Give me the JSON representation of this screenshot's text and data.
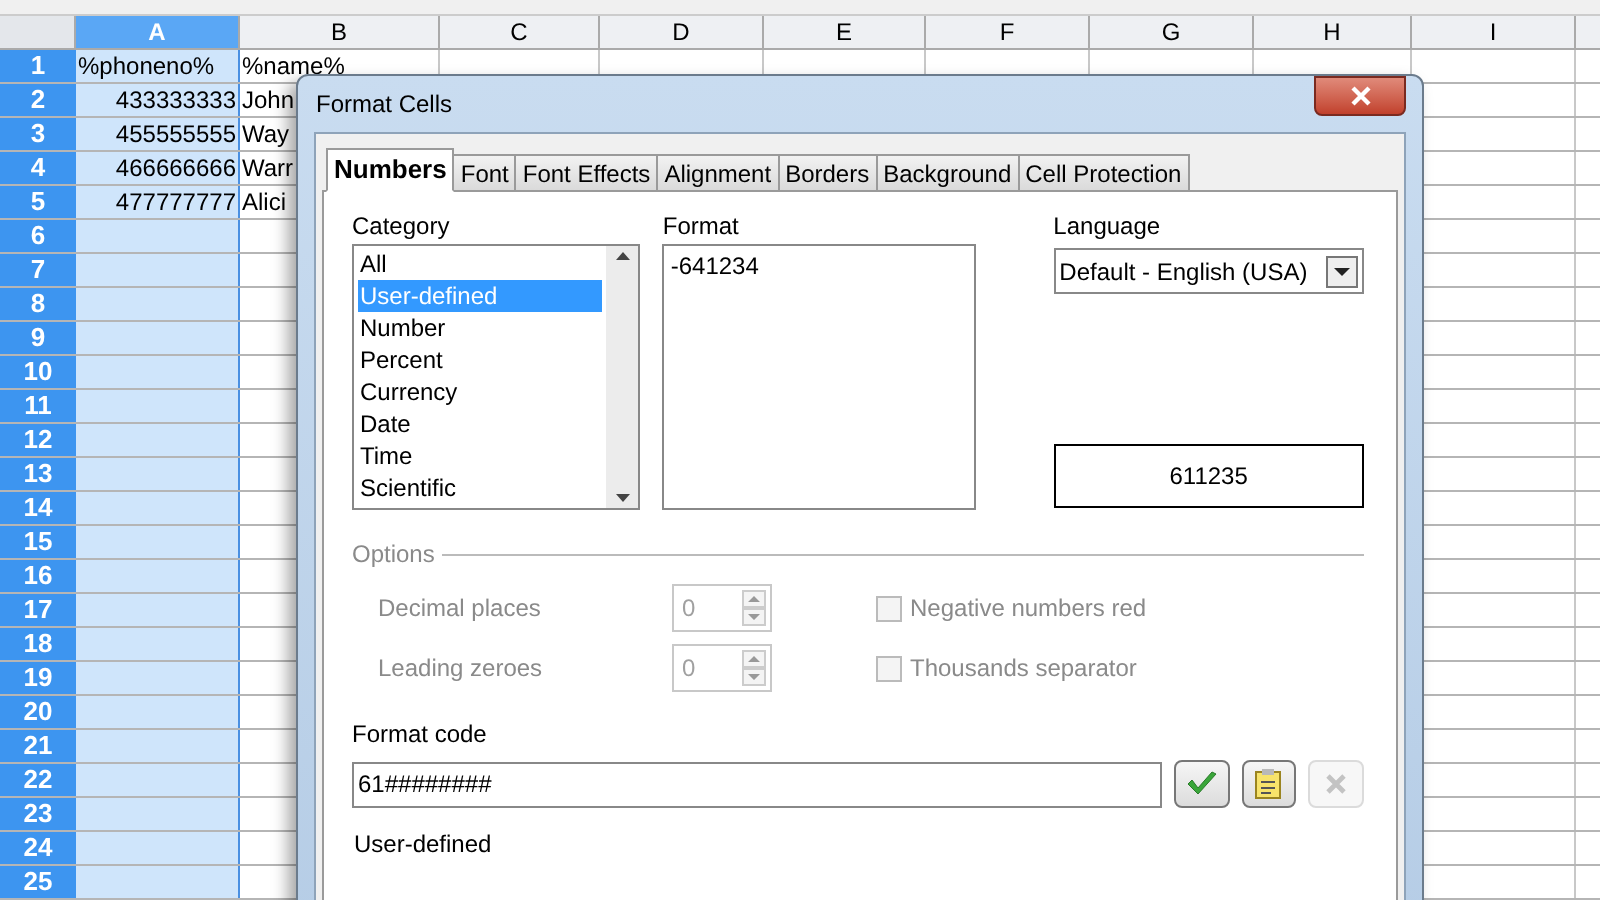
{
  "sheet": {
    "columns": [
      {
        "label": "A",
        "selected": true
      },
      {
        "label": "B",
        "selected": false
      },
      {
        "label": "C",
        "selected": false
      },
      {
        "label": "D",
        "selected": false
      },
      {
        "label": "E",
        "selected": false
      },
      {
        "label": "F",
        "selected": false
      },
      {
        "label": "G",
        "selected": false
      },
      {
        "label": "H",
        "selected": false
      },
      {
        "label": "I",
        "selected": false
      }
    ],
    "rows": [
      {
        "label": "1",
        "cells": [
          "%phoneno%",
          "%name%"
        ]
      },
      {
        "label": "2",
        "cells": [
          "433333333",
          "John"
        ]
      },
      {
        "label": "3",
        "cells": [
          "455555555",
          "Way"
        ]
      },
      {
        "label": "4",
        "cells": [
          "466666666",
          "Warr"
        ]
      },
      {
        "label": "5",
        "cells": [
          "477777777",
          "Alici"
        ]
      },
      {
        "label": "6",
        "cells": []
      },
      {
        "label": "7",
        "cells": []
      },
      {
        "label": "8",
        "cells": []
      },
      {
        "label": "9",
        "cells": []
      },
      {
        "label": "10",
        "cells": []
      },
      {
        "label": "11",
        "cells": []
      },
      {
        "label": "12",
        "cells": []
      },
      {
        "label": "13",
        "cells": []
      },
      {
        "label": "14",
        "cells": []
      },
      {
        "label": "15",
        "cells": []
      },
      {
        "label": "16",
        "cells": []
      },
      {
        "label": "17",
        "cells": []
      },
      {
        "label": "18",
        "cells": []
      },
      {
        "label": "19",
        "cells": []
      },
      {
        "label": "20",
        "cells": []
      },
      {
        "label": "21",
        "cells": []
      },
      {
        "label": "22",
        "cells": []
      },
      {
        "label": "23",
        "cells": []
      },
      {
        "label": "24",
        "cells": []
      },
      {
        "label": "25",
        "cells": []
      }
    ]
  },
  "dialog": {
    "title": "Format Cells",
    "tabs": [
      {
        "label": "Numbers",
        "selected": true
      },
      {
        "label": "Font",
        "selected": false
      },
      {
        "label": "Font Effects",
        "selected": false
      },
      {
        "label": "Alignment",
        "selected": false
      },
      {
        "label": "Borders",
        "selected": false
      },
      {
        "label": "Background",
        "selected": false
      },
      {
        "label": "Cell Protection",
        "selected": false
      }
    ],
    "category": {
      "label": "Category",
      "items": [
        {
          "label": "All",
          "selected": false
        },
        {
          "label": "User-defined",
          "selected": true
        },
        {
          "label": "Number",
          "selected": false
        },
        {
          "label": "Percent",
          "selected": false
        },
        {
          "label": "Currency",
          "selected": false
        },
        {
          "label": "Date",
          "selected": false
        },
        {
          "label": "Time",
          "selected": false
        },
        {
          "label": "Scientific",
          "selected": false
        }
      ]
    },
    "format": {
      "label": "Format",
      "items": [
        "-641234"
      ]
    },
    "language": {
      "label": "Language",
      "value": "Default - English (USA)"
    },
    "preview": "611235",
    "options": {
      "label": "Options",
      "disabled": true,
      "spinners": [
        {
          "label": "Decimal places",
          "value": "0"
        },
        {
          "label": "Leading zeroes",
          "value": "0"
        }
      ],
      "checkboxes": [
        {
          "label": "Negative numbers red",
          "checked": false
        },
        {
          "label": "Thousands separator",
          "checked": false
        }
      ]
    },
    "format_code": {
      "label": "Format code",
      "value": "61########"
    },
    "buttons": [
      {
        "kind": "accept",
        "disabled": false
      },
      {
        "kind": "comment",
        "disabled": false
      },
      {
        "kind": "delete",
        "disabled": true
      }
    ],
    "description": "User-defined"
  }
}
